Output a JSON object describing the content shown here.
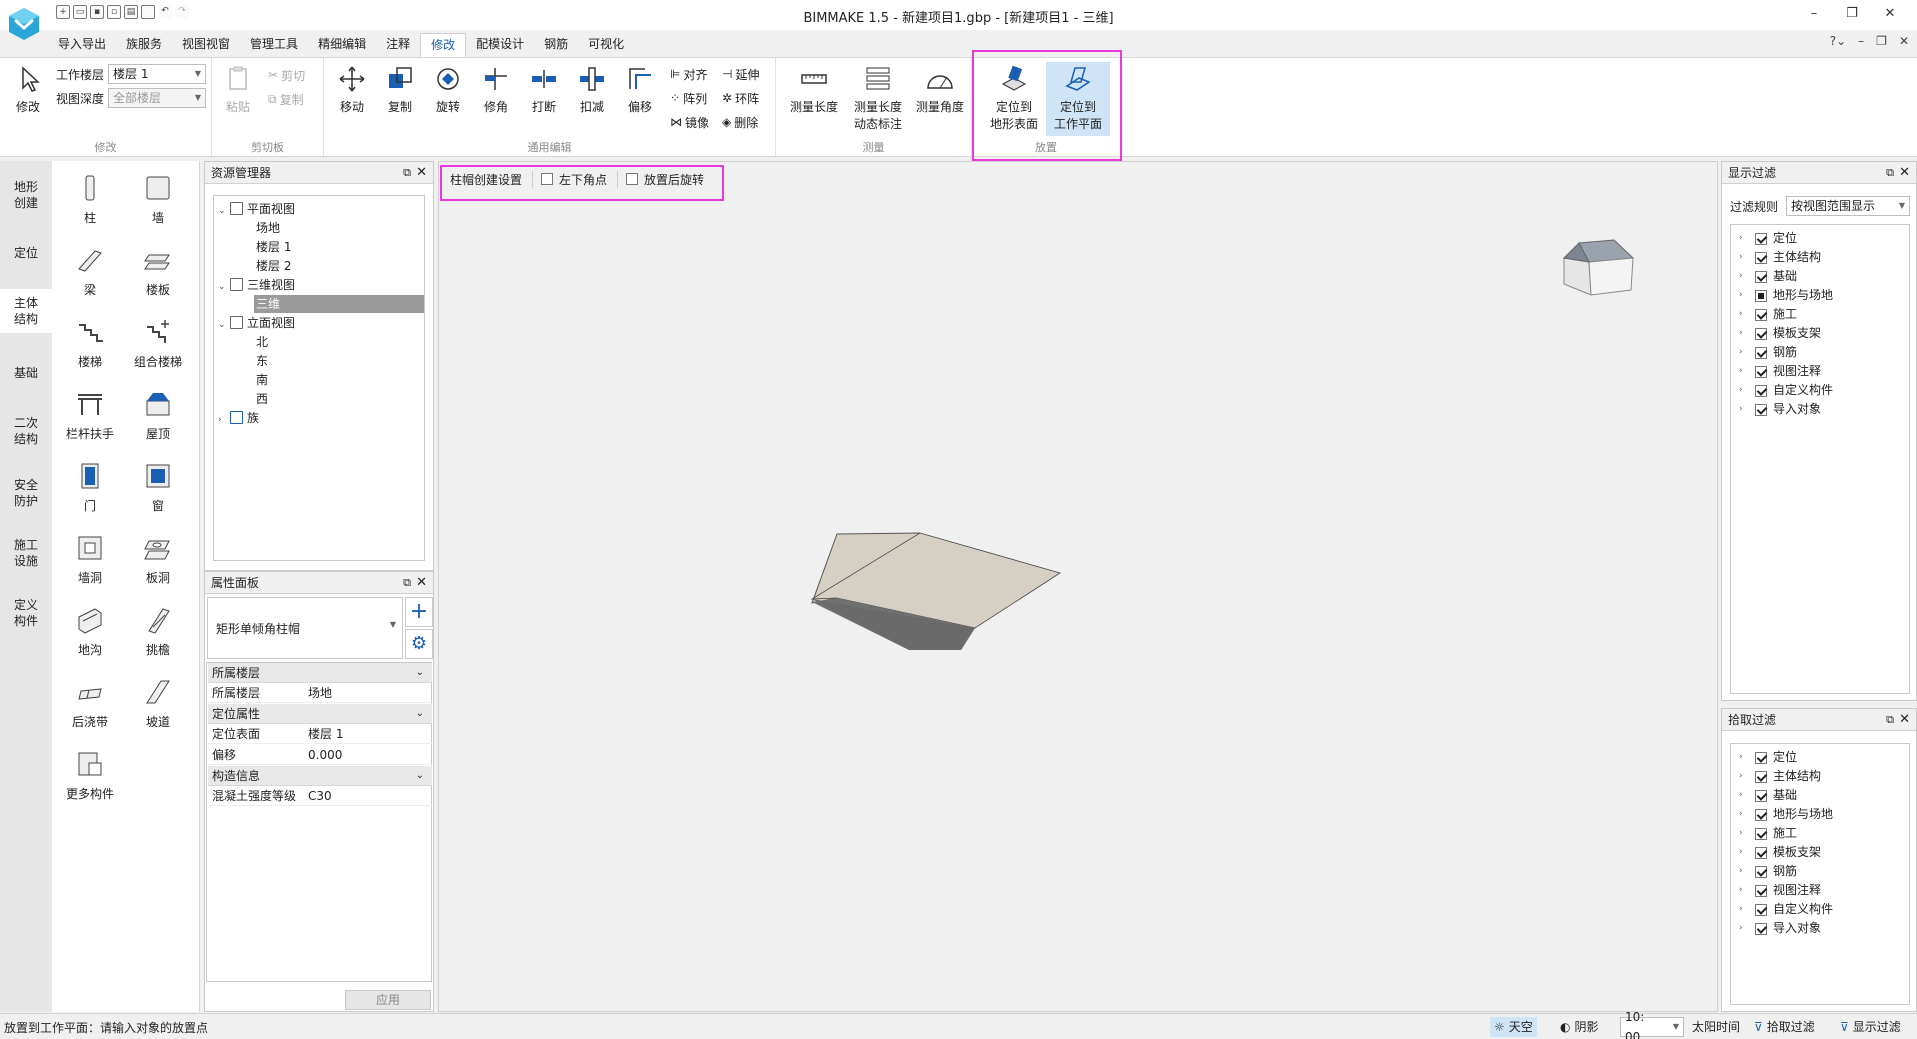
{
  "window": {
    "title": "BIMMAKE 1.5 - 新建项目1.gbp - [新建项目1 - 三维]",
    "controls": [
      "–",
      "❐",
      "✕"
    ]
  },
  "ribbon_tabs": [
    "导入导出",
    "族服务",
    "视图视窗",
    "管理工具",
    "精细编辑",
    "注释",
    "修改",
    "配模设计",
    "钢筋",
    "可视化"
  ],
  "active_tab": "修改",
  "ribbon": {
    "modify": {
      "group": "修改",
      "btn": "修改",
      "work_floor_label": "工作楼层",
      "work_floor_value": "楼层 1",
      "view_depth_label": "视图深度",
      "view_depth_value": "全部楼层"
    },
    "clipboard": {
      "group": "剪切板",
      "paste": "粘贴",
      "cut": "剪切",
      "copy": "复制"
    },
    "general_edit": {
      "group": "通用编辑",
      "move": "移动",
      "copy": "复制",
      "rotate": "旋转",
      "trim": "修角",
      "break": "打断",
      "deduct": "扣减",
      "offset": "偏移",
      "align": "对齐",
      "array": "阵列",
      "mirror": "镜像",
      "extend": "延伸",
      "ring_array": "环阵",
      "delete": "删除"
    },
    "measure": {
      "group": "测量",
      "length": "测量长度",
      "dynamic_l1": "测量长度",
      "dynamic_l2": "动态标注",
      "angle": "测量角度"
    },
    "place": {
      "group": "放置",
      "terrain_l1": "定位到",
      "terrain_l2": "地形表面",
      "plane_l1": "定位到",
      "plane_l2": "工作平面"
    }
  },
  "categories": [
    "地形\n创建",
    "定位",
    "主体\n结构",
    "基础",
    "二次\n结构",
    "安全\n防护",
    "施工\n设施",
    "定义\n构件"
  ],
  "active_category": 2,
  "components": [
    "柱",
    "墙",
    "梁",
    "楼板",
    "楼梯",
    "组合楼梯",
    "栏杆扶手",
    "屋顶",
    "门",
    "窗",
    "墙洞",
    "板洞",
    "地沟",
    "挑檐",
    "后浇带",
    "坡道",
    "更多构件"
  ],
  "resource_manager": {
    "title": "资源管理器",
    "tree": [
      {
        "label": "平面视图",
        "level": 0,
        "toggle": "⌄"
      },
      {
        "label": "场地",
        "level": 1
      },
      {
        "label": "楼层 1",
        "level": 1
      },
      {
        "label": "楼层 2",
        "level": 1
      },
      {
        "label": "三维视图",
        "level": 0,
        "toggle": "⌄"
      },
      {
        "label": "三维",
        "level": 1,
        "selected": true
      },
      {
        "label": "立面视图",
        "level": 0,
        "toggle": "⌄"
      },
      {
        "label": "北",
        "level": 1
      },
      {
        "label": "东",
        "level": 1
      },
      {
        "label": "南",
        "level": 1
      },
      {
        "label": "西",
        "level": 1
      },
      {
        "label": "族",
        "level": 0,
        "toggle": "›"
      }
    ]
  },
  "properties": {
    "title": "属性面板",
    "type_name": "矩形单倾角柱帽",
    "sections": [
      {
        "name": "所属楼层",
        "rows": [
          [
            "所属楼层",
            "场地"
          ]
        ]
      },
      {
        "name": "定位属性",
        "rows": [
          [
            "定位表面",
            "楼层 1"
          ],
          [
            "偏移",
            "0.000"
          ]
        ]
      },
      {
        "name": "构造信息",
        "rows": [
          [
            "混凝土强度等级",
            "C30"
          ]
        ]
      }
    ],
    "apply": "应用"
  },
  "options_bar": {
    "settings": "柱帽创建设置",
    "corner": "左下角点",
    "rotate_after": "放置后旋转"
  },
  "display_filter": {
    "title": "显示过滤",
    "rule_label": "过滤规则",
    "rule_value": "按视图范围显示",
    "items": [
      "定位",
      "主体结构",
      "基础",
      "地形与场地",
      "施工",
      "模板支架",
      "钢筋",
      "视图注释",
      "自定义构件",
      "导入对象"
    ],
    "partial_index": 3
  },
  "pick_filter": {
    "title": "拾取过滤",
    "items": [
      "定位",
      "主体结构",
      "基础",
      "地形与场地",
      "施工",
      "模板支架",
      "钢筋",
      "视图注释",
      "自定义构件",
      "导入对象"
    ]
  },
  "status": {
    "text": "放置到工作平面：请输入对象的放置点",
    "sky": "天空",
    "shadow": "阴影",
    "time": "10: 00",
    "sun_time": "太阳时间",
    "pick_filter": "拾取过滤",
    "display_filter": "显示过滤"
  },
  "colors": {
    "accent": "#1a5fb4",
    "highlight": "#e83ad8",
    "slab_top": "#d6cfc4",
    "slab_side": "#707070"
  }
}
